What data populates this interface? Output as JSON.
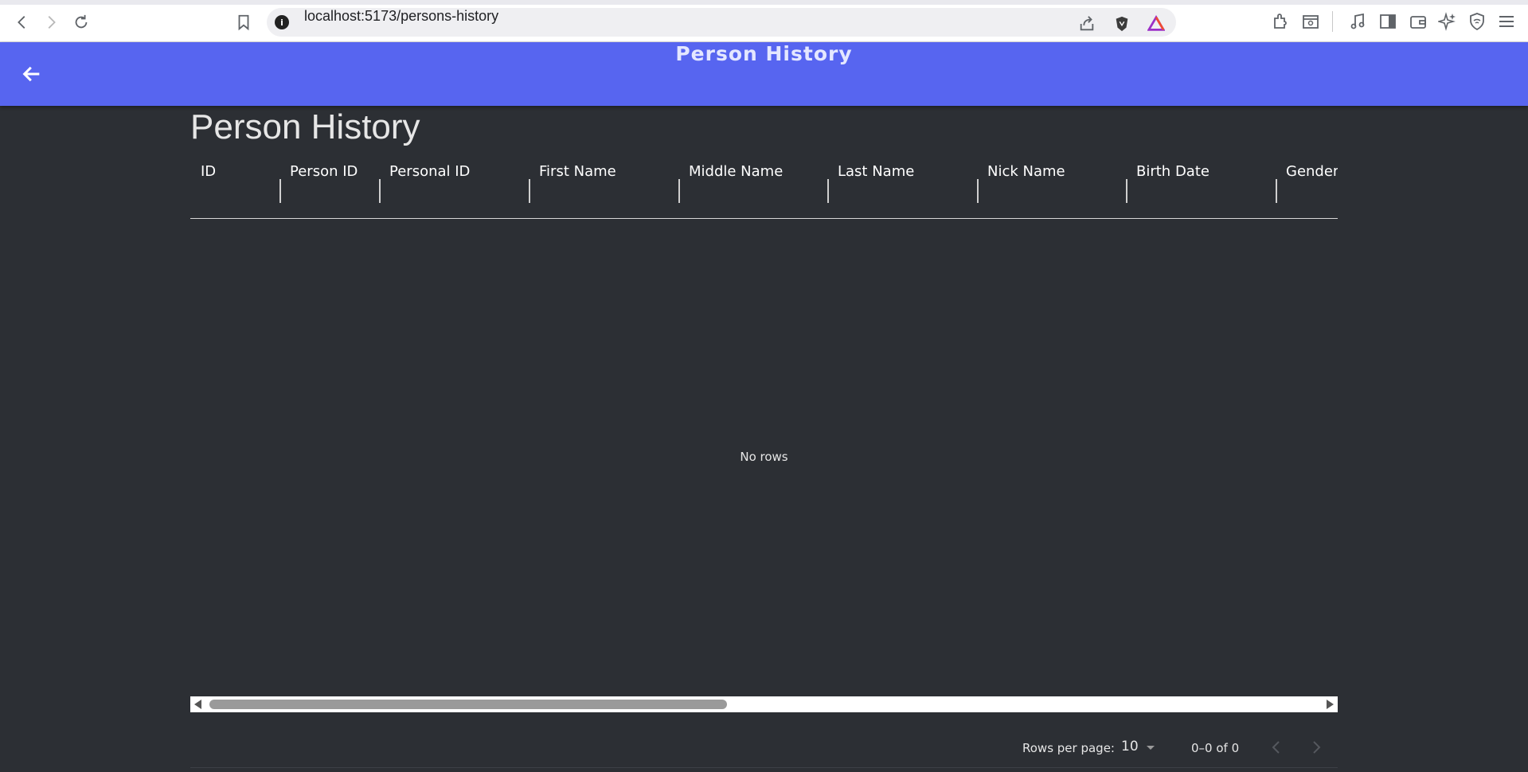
{
  "browser": {
    "url": "localhost:5173/persons-history",
    "info_icon": "i"
  },
  "app_bar": {
    "title": "Person History"
  },
  "page": {
    "heading": "Person History"
  },
  "grid": {
    "columns": [
      "ID",
      "Person ID",
      "Personal ID",
      "First Name",
      "Middle Name",
      "Last Name",
      "Nick Name",
      "Birth Date",
      "Gender"
    ],
    "rows": [],
    "empty_text": "No rows"
  },
  "pagination": {
    "rows_per_page_label": "Rows per page:",
    "rows_per_page_value": "10",
    "range_label": "0–0 of 0"
  },
  "colors": {
    "app_bar": "#5765f0",
    "background": "#2c2f34"
  }
}
